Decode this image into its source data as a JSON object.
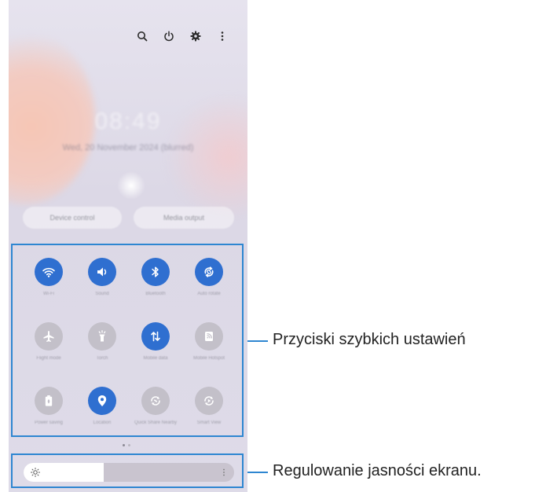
{
  "panel": {
    "top_icons": [
      "search-icon",
      "power-icon",
      "settings-icon",
      "more-vert-icon"
    ],
    "clock_text": "08:49",
    "date_text": "Wed, 20 November 2024 (blurred)",
    "device_control_label": "Device control",
    "media_output_label": "Media output",
    "tiles": [
      {
        "label": "Wi-Fi",
        "icon": "wifi-icon",
        "active": true
      },
      {
        "label": "Sound",
        "icon": "volume-icon",
        "active": true
      },
      {
        "label": "Bluetooth",
        "icon": "bluetooth-icon",
        "active": true
      },
      {
        "label": "Auto rotate",
        "icon": "auto-rotate-icon",
        "active": true
      },
      {
        "label": "Flight mode",
        "icon": "airplane-icon",
        "active": false
      },
      {
        "label": "Torch",
        "icon": "flashlight-icon",
        "active": false
      },
      {
        "label": "Mobile data",
        "icon": "mobile-data-icon",
        "active": true
      },
      {
        "label": "Mobile Hotspot",
        "icon": "hotspot-icon",
        "active": false
      },
      {
        "label": "Power saving",
        "icon": "battery-icon",
        "active": false
      },
      {
        "label": "Location",
        "icon": "location-icon",
        "active": true
      },
      {
        "label": "Quick Share Nearby",
        "icon": "quick-share-icon",
        "active": false
      },
      {
        "label": "Smart View",
        "icon": "smart-view-icon",
        "active": false
      }
    ],
    "brightness_level": 0.38
  },
  "callouts": {
    "quick_settings": "Przyciski szybkich ustawień",
    "brightness": "Regulowanie jasności ekranu."
  },
  "colors": {
    "accent_blue": "#2f6fd0",
    "frame_blue": "#2e86d1",
    "tile_off": "#c3c0c9"
  }
}
